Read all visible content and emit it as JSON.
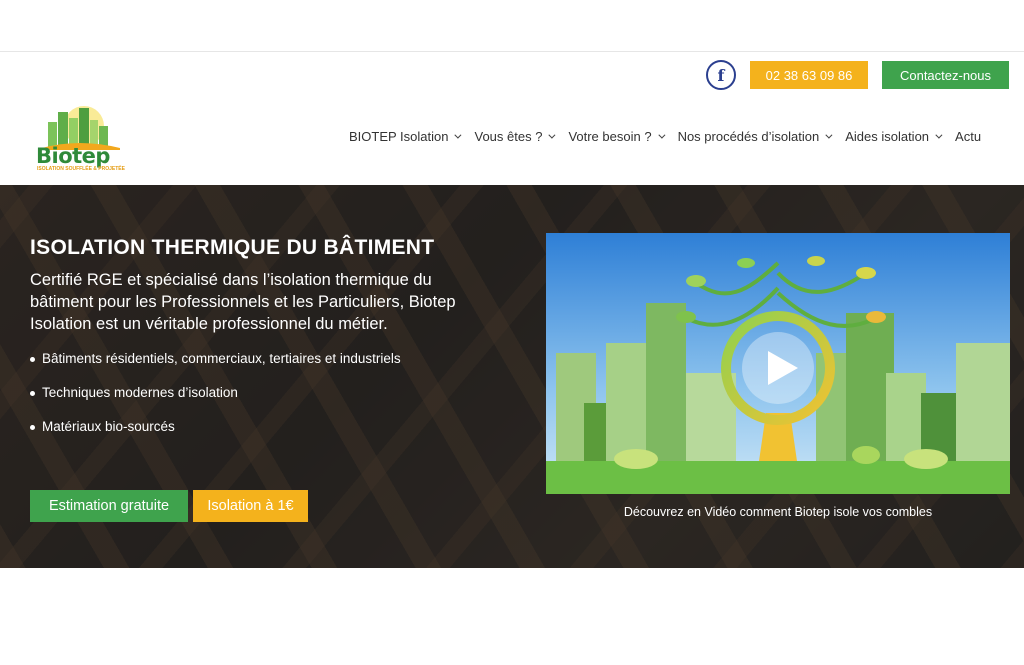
{
  "topbar": {
    "facebook_icon": "facebook-icon",
    "phone": "02 38 63 09 86",
    "contact": "Contactez-nous"
  },
  "logo": {
    "name": "Biotep",
    "tagline": "ISOLATION SOUFFLÉE & PROJETÉE"
  },
  "nav": {
    "items": [
      {
        "label": "BIOTEP Isolation"
      },
      {
        "label": "Vous êtes ?"
      },
      {
        "label": "Votre besoin ?"
      },
      {
        "label": "Nos procédés d’isolation"
      },
      {
        "label": "Aides isolation"
      },
      {
        "label": "Actu"
      }
    ]
  },
  "hero": {
    "title": "ISOLATION THERMIQUE DU BÂTIMENT",
    "description": "Certifié RGE et spécialisé dans l’isolation thermique du bâtiment pour les Professionnels et les Particuliers, Biotep Isolation est un véritable professionnel du métier.",
    "bullets": [
      "Bâtiments résidentiels, commerciaux, tertiaires et industriels",
      "Techniques modernes d’isolation",
      "Matériaux bio-sourcés"
    ],
    "cta_primary": "Estimation gratuite",
    "cta_secondary": "Isolation à 1€"
  },
  "video": {
    "caption": "Découvrez en Vidéo comment Biotep isole vos combles",
    "play_icon": "play-icon"
  },
  "colors": {
    "green": "#3fa34d",
    "orange": "#f4b21c",
    "facebook": "#2b3f8f"
  }
}
